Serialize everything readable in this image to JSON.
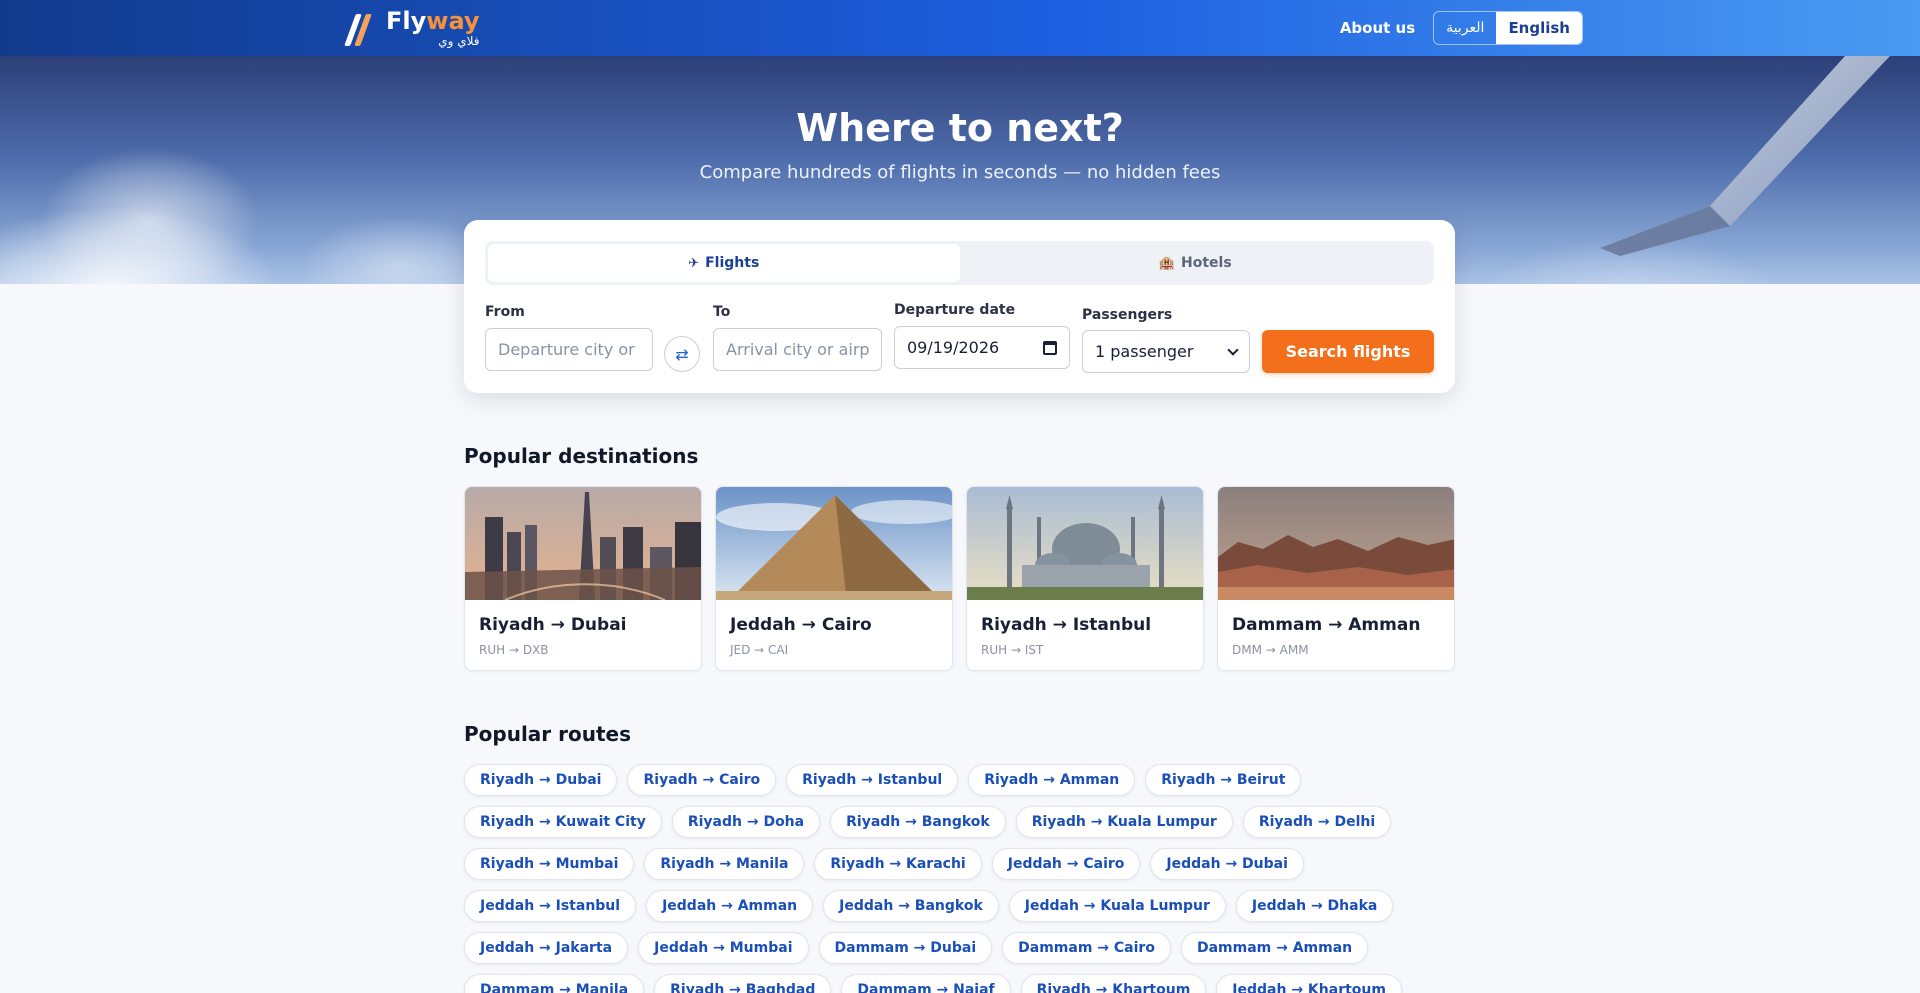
{
  "header": {
    "logo_word_1": "Fly",
    "logo_word_2": "way",
    "logo_arabic": "فلاي وي",
    "about_label": "About us",
    "lang_arabic": "العربية",
    "lang_english": "English"
  },
  "hero": {
    "title": "Where to next?",
    "subtitle": "Compare hundreds of flights in seconds — no hidden fees"
  },
  "search": {
    "tabs": [
      {
        "icon": "✈",
        "label": "Flights",
        "active": true
      },
      {
        "icon": "🏨",
        "label": "Hotels",
        "active": false
      }
    ],
    "from_label": "From",
    "from_placeholder": "Departure city or airport",
    "swap_icon": "⇄",
    "to_label": "To",
    "to_placeholder": "Arrival city or airport",
    "date_label": "Departure date",
    "date_value": "09/19/2026",
    "passengers_label": "Passengers",
    "passengers_value": "1 passenger",
    "button_label": "Search flights"
  },
  "popular_destinations": {
    "title": "Popular destinations",
    "items": [
      {
        "title": "Riyadh → Dubai",
        "code": "RUH → DXB",
        "image": "city-skyline"
      },
      {
        "title": "Jeddah → Cairo",
        "code": "JED → CAI",
        "image": "pyramid"
      },
      {
        "title": "Riyadh → Istanbul",
        "code": "RUH → IST",
        "image": "mosque"
      },
      {
        "title": "Dammam → Amman",
        "code": "DMM → AMM",
        "image": "desert"
      }
    ]
  },
  "popular_routes": {
    "title": "Popular routes",
    "rows": [
      [
        "Riyadh → Dubai",
        "Riyadh → Cairo",
        "Riyadh → Istanbul",
        "Riyadh → Amman",
        "Riyadh → Beirut"
      ],
      [
        "Riyadh → Kuwait City",
        "Riyadh → Doha",
        "Riyadh → Bangkok",
        "Riyadh → Kuala Lumpur",
        "Riyadh → Delhi"
      ],
      [
        "Riyadh → Mumbai",
        "Riyadh → Manila",
        "Riyadh → Karachi",
        "Jeddah → Cairo",
        "Jeddah → Dubai"
      ],
      [
        "Jeddah → Istanbul",
        "Jeddah → Amman",
        "Jeddah → Bangkok",
        "Jeddah → Kuala Lumpur",
        "Jeddah → Dhaka"
      ],
      [
        "Jeddah → Jakarta",
        "Jeddah → Mumbai",
        "Dammam → Dubai",
        "Dammam → Cairo",
        "Dammam → Amman"
      ],
      [
        "Dammam → Manila",
        "Riyadh → Baghdad",
        "Dammam → Najaf",
        "Riyadh → Khartoum",
        "Jeddah → Khartoum"
      ]
    ]
  },
  "colors": {
    "header_start": "#123a8c",
    "header_end": "#4a9bf2",
    "accent_orange": "#f36f1c",
    "link_blue": "#1b4fb8"
  }
}
